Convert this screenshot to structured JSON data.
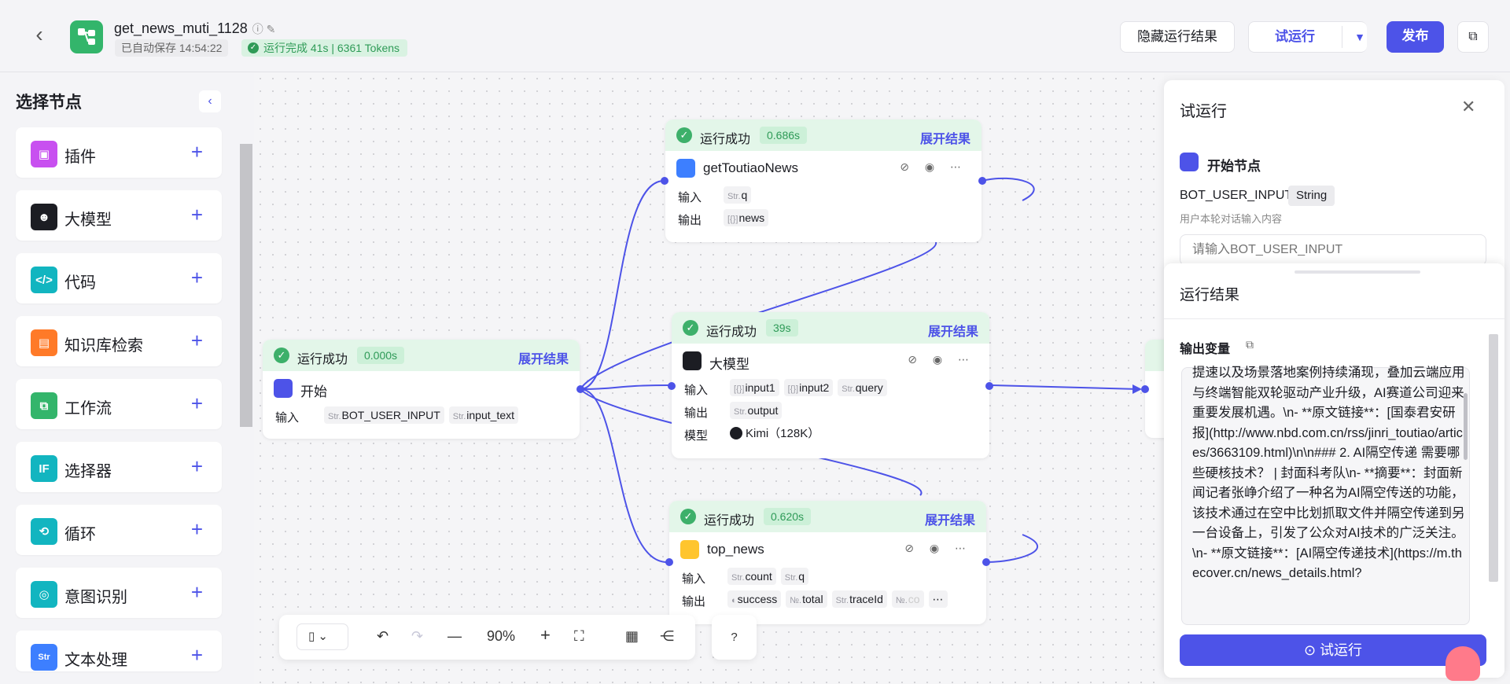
{
  "header": {
    "title": "get_news_muti_1128",
    "saved": "已自动保存 14:54:22",
    "run_status": "运行完成 41s | 6361 Tokens",
    "hide_results": "隐藏运行结果",
    "test_run": "试运行",
    "publish": "发布"
  },
  "sidebar": {
    "title": "选择节点",
    "items": [
      {
        "label": "插件",
        "icon": "cube-icon",
        "color": "#c850f0"
      },
      {
        "label": "大模型",
        "icon": "llm-icon",
        "color": "#1c1d23"
      },
      {
        "label": "代码",
        "icon": "code-icon",
        "color": "#12b5c0"
      },
      {
        "label": "知识库检索",
        "icon": "knowledge-icon",
        "color": "#ff7a28"
      },
      {
        "label": "工作流",
        "icon": "workflow-icon",
        "color": "#33b56b"
      },
      {
        "label": "选择器",
        "icon": "if-icon",
        "color": "#12b5c0"
      },
      {
        "label": "循环",
        "icon": "loop-icon",
        "color": "#12b5c0"
      },
      {
        "label": "意图识别",
        "icon": "intent-icon",
        "color": "#12b5c0"
      },
      {
        "label": "文本处理",
        "icon": "text-icon",
        "color": "#3d7fff"
      }
    ]
  },
  "nodes": {
    "news": {
      "status": "运行成功",
      "time": "0.686s",
      "expand": "展开结果",
      "name": "getToutiaoNews",
      "in_label": "输入",
      "in_type": "Str.",
      "in_val": "q",
      "out_label": "输出",
      "out_type": "[{}]",
      "out_val": "news"
    },
    "start": {
      "status": "运行成功",
      "time": "0.000s",
      "expand": "展开结果",
      "name": "开始",
      "in_label": "输入",
      "in1_type": "Str.",
      "in1": "BOT_USER_INPUT",
      "in2_type": "Str.",
      "in2": "input_text"
    },
    "llm": {
      "status": "运行成功",
      "time": "39s",
      "expand": "展开结果",
      "name": "大模型",
      "in_label": "输入",
      "in1_type": "[{}]",
      "in1": "input1",
      "in2_type": "[{}]",
      "in2": "input2",
      "in3_type": "Str.",
      "in3": "query",
      "out_label": "输出",
      "out_type": "Str.",
      "out_val": "output",
      "model_label": "模型",
      "model": "Kimi（128K）"
    },
    "top": {
      "status": "运行成功",
      "time": "0.620s",
      "expand": "展开结果",
      "name": "top_news",
      "in_label": "输入",
      "in1_type": "Str.",
      "in1": "count",
      "in2_type": "Str.",
      "in2": "q",
      "out_label": "输出",
      "o1": "success",
      "o2_type": "№.",
      "o2": "total",
      "o3_type": "Str.",
      "o3": "traceId",
      "o4_type": "№.",
      "o4": "co"
    }
  },
  "toolbar": {
    "zoom": "90%"
  },
  "panel": {
    "title": "试运行",
    "start_node": "开始节点",
    "var_name": "BOT_USER_INPUT",
    "var_type": "String",
    "var_desc": "用户本轮对话输入内容",
    "input_placeholder": "请输入BOT_USER_INPUT",
    "results_title": "运行结果",
    "output_var_label": "输出变量",
    "output_text": "提速以及场景落地案例持续涌现，叠加云端应用与终端智能双轮驱动产业升级，AI赛道公司迎来重要发展机遇。\\n- **原文链接**：[国泰君安研报](http://www.nbd.com.cn/rss/jinri_toutiao/articles/3663109.html)\\n\\n### 2. AI隔空传递 需要哪些硬核技术？ | 封面科考队\\n- **摘要**：封面新闻记者张峥介绍了一种名为AI隔空传送的功能，该技术通过在空中比划抓取文件并隔空传递到另一台设备上，引发了公众对AI技术的广泛关注。\\n- **原文链接**：[AI隔空传递技术](https://m.thecover.cn/news_details.html?",
    "run_button": "试运行"
  }
}
